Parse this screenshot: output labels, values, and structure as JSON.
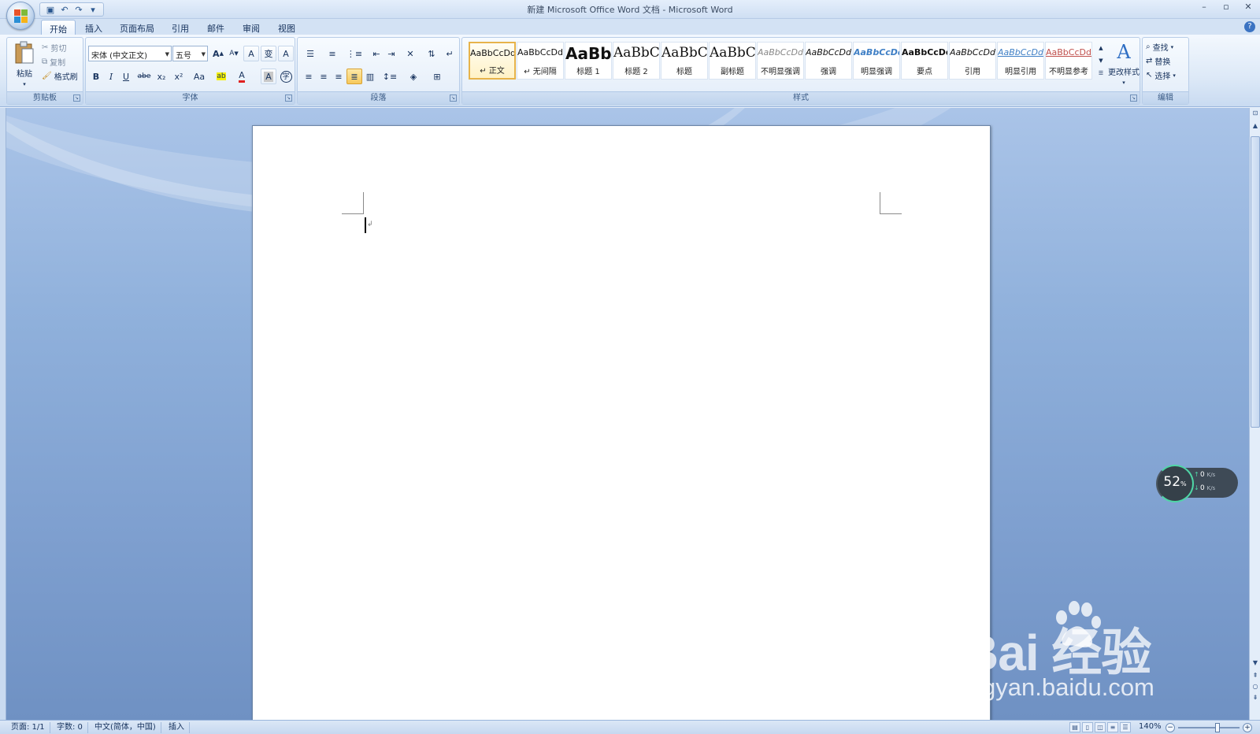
{
  "window": {
    "title": "新建 Microsoft Office Word 文档 - Microsoft Word",
    "controls": [
      "–",
      "▫",
      "✕"
    ]
  },
  "quick_access": {
    "items": [
      "save-icon",
      "undo-icon",
      "redo-icon",
      "customize-icon"
    ]
  },
  "tabs": [
    "开始",
    "插入",
    "页面布局",
    "引用",
    "邮件",
    "审阅",
    "视图"
  ],
  "active_tab": "开始",
  "clipboard": {
    "paste": "粘贴",
    "cut": "剪切",
    "copy": "复制",
    "format_painter": "格式刷",
    "group_label": "剪贴板"
  },
  "font": {
    "name": "宋体 (中文正文)",
    "size": "五号",
    "grow": "A",
    "shrink": "A",
    "clear_format": "A",
    "phonetic": "变",
    "char_border": "A",
    "bold": "B",
    "italic": "I",
    "underline": "U",
    "strike": "abe",
    "subscript": "x₂",
    "superscript": "x²",
    "change_case": "Aa",
    "highlight": "ab",
    "font_color": "A",
    "char_shading": "A",
    "enclose": "字",
    "group_label": "字体"
  },
  "paragraph": {
    "group_label": "段落"
  },
  "styles": {
    "items": [
      {
        "sample": "AaBbCcDd",
        "name": "↵ 正文",
        "selected": true
      },
      {
        "sample": "AaBbCcDd",
        "name": "↵ 无间隔"
      },
      {
        "sample": "AaBb",
        "name": "标题 1"
      },
      {
        "sample": "AaBbC",
        "name": "标题 2"
      },
      {
        "sample": "AaBbC",
        "name": "标题"
      },
      {
        "sample": "AaBbC",
        "name": "副标题"
      },
      {
        "sample": "AaBbCcDd",
        "name": "不明显强调"
      },
      {
        "sample": "AaBbCcDd",
        "name": "强调"
      },
      {
        "sample": "AaBbCcDd",
        "name": "明显强调"
      },
      {
        "sample": "AaBbCcDd",
        "name": "要点"
      },
      {
        "sample": "AaBbCcDd",
        "name": "引用"
      },
      {
        "sample": "AaBbCcDd",
        "name": "明显引用"
      },
      {
        "sample": "AaBbCcDd",
        "name": "不明显参考"
      }
    ],
    "change_styles": "更改样式",
    "group_label": "样式"
  },
  "editing": {
    "find": "查找",
    "replace": "替换",
    "select": "选择",
    "group_label": "编辑"
  },
  "network_widget": {
    "percent": "52",
    "percent_unit": "%",
    "upload": "0",
    "download": "0",
    "rate_unit": "K/s"
  },
  "watermark": {
    "brand": "Bai  经验",
    "url": "jingyan.baidu.com"
  },
  "status": {
    "page": "页面: 1/1",
    "words": "字数: 0",
    "language": "中文(简体，中国)",
    "mode": "插入",
    "zoom": "140%"
  },
  "colors": {
    "accent": "#2b579a",
    "ribbon_bg": "#dde9f7",
    "doc_bg": "#8fb0db",
    "selected_style": "#e7b34a",
    "widget_ring": "#4fd6a6"
  }
}
